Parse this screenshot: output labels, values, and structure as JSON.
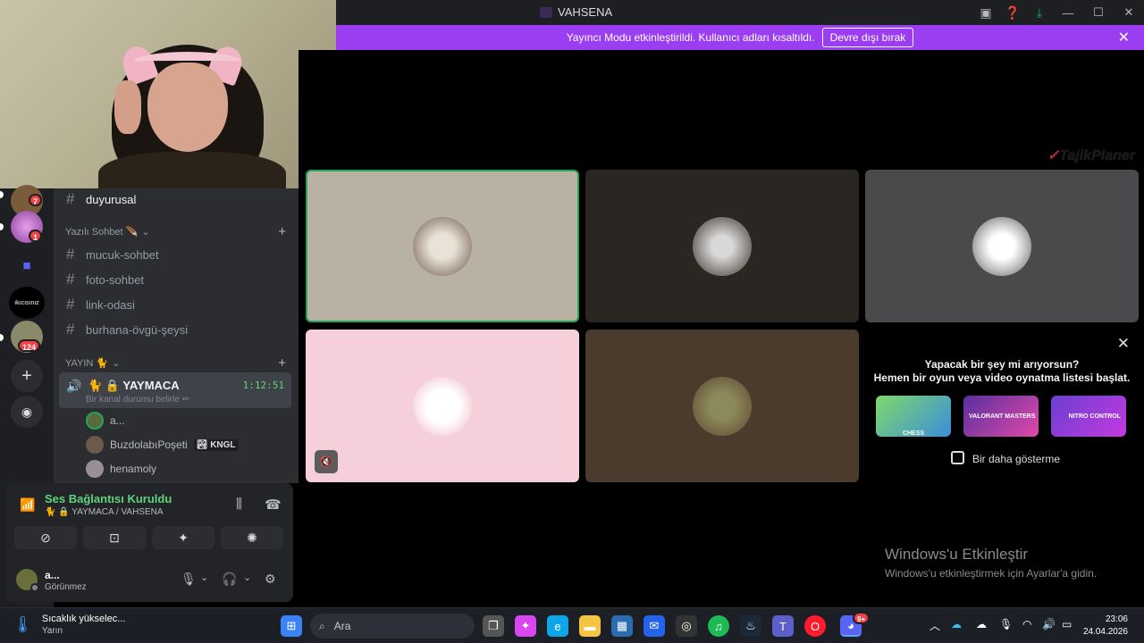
{
  "window": {
    "title": "VAHSENA"
  },
  "notice": {
    "text": "Yayıncı Modu etkinleştirildi. Kullanıcı adları kısaltıldı.",
    "button": "Devre dışı bırak"
  },
  "servers": [
    {
      "badge": "7"
    },
    {
      "badge": "1"
    },
    {
      "label": "ıkıcısınız"
    },
    {
      "badge": "124"
    }
  ],
  "channels": {
    "top": "duyurusal",
    "category1": "Yazılı Sohbet 🪶",
    "text_channels": [
      "mucuk-sohbet",
      "foto-sohbet",
      "link-odasi",
      "burhana-övgü-şeysi"
    ],
    "category2": "YAYIN 🐈",
    "voice": {
      "name": "🐈 🔒 YAYMACA",
      "time": "1:12:51",
      "status": "Bir kanal durumu belirle ✏"
    },
    "voice_users": [
      {
        "name": "a...",
        "tag": ""
      },
      {
        "name": "BuzdolabıPoşeti",
        "tag": "🏞 KNGL"
      },
      {
        "name": "henamoly",
        "tag": ""
      }
    ]
  },
  "voice_panel": {
    "connection": "Ses Bağlantısı Kuruldu",
    "location": "🐈 🔒 YAYMACA / VAHSENA"
  },
  "user": {
    "name": "a...",
    "status": "Görünmez"
  },
  "stage": {
    "brand": "TajikPlaner"
  },
  "promo": {
    "title_line1": "Yapacak bir şey mi arıyorsun?",
    "title_line2": "Hemen bir oyun veya video oynatma listesi başlat.",
    "thumbs": [
      "CHESS",
      "VALORANT MASTERS",
      "NITRO CONTROL"
    ],
    "checkbox_label": "Bir daha gösterme"
  },
  "watermark": {
    "title": "Windows'u Etkinleştir",
    "sub": "Windows'u etkinleştirmek için Ayarlar'a gidin."
  },
  "taskbar": {
    "weather_title": "Sıcaklık yükselec...",
    "weather_sub": "Yarın",
    "search_placeholder": "Ara",
    "time": "23:06",
    "date": "24.04.2026",
    "discord_badge": "9+"
  },
  "colors": {
    "accent": "#9b3ef2",
    "speaking": "#23a55a",
    "tile_pink": "#f5cfd9"
  }
}
